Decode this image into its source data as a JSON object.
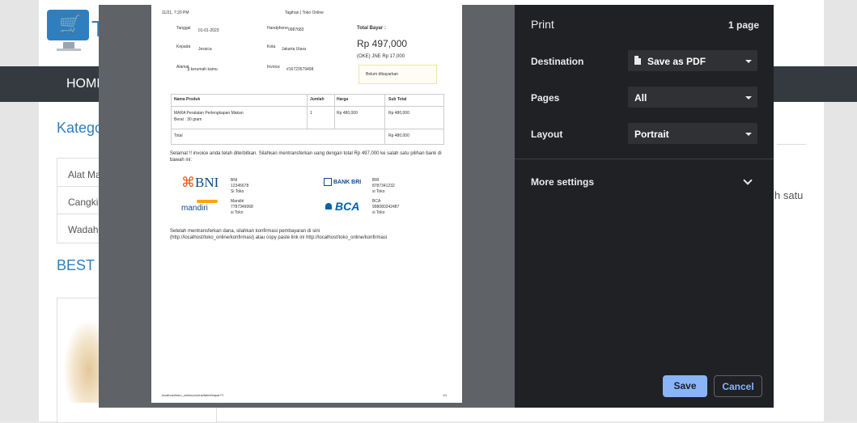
{
  "website": {
    "nav_home": "HOME",
    "logo_letter": "T",
    "category_title": "Kategori",
    "categories": [
      "Alat Mal",
      "Cangkir",
      "Wadah S"
    ],
    "best_seller_title": "BEST SEL",
    "side_text": "h satu"
  },
  "invoice": {
    "header_time": "11/21, 7:20 PM",
    "header_title": "Tagihan | Toko Online",
    "tanggal_label": "Tanggal",
    "tanggal_value": "01-01-2023",
    "handphone_label": "Handphone",
    "handphone_value": "0987683",
    "total_bayar_label": "Total Bayar :",
    "kepada_label": "Kepada",
    "kepada_value": "Jessica",
    "kota_label": "Kota",
    "kota_value": "Jakarta Utara",
    "total_amount": "Rp 497,000",
    "shipping": "(OKE) JNE Rp 17,000",
    "alamat_label": "Alamat",
    "alamat_value": "jl.kerumah kamu",
    "invoice_label": "Invoice",
    "invoice_value": "#16723579498",
    "status": "Belum dibayarkan",
    "table_headers": [
      "Nama Produk",
      "Jumlah",
      "Harga",
      "Sub Total"
    ],
    "row_product": "MARA Peralatan Perlengkapan Makan",
    "row_product_2": "Berat : 30 gram",
    "row_qty": "1",
    "row_price": "Rp 480,000",
    "row_subtotal": "Rp 480,000",
    "total_label": "Total",
    "total_value": "Rp 480,000",
    "message": "Selamat !! invoice anda telah diterbitkan. Silahkan mentransferkan uang dengan total Rp 497,000 ke salah satu pilihan bank di bawah ini:",
    "bni_logo": "BNI",
    "bni_info": [
      "BNI",
      "12345678",
      "Si Toko"
    ],
    "mandiri_logo": "mandiri",
    "mandiri_info": [
      "Mandiri",
      "7787349068",
      "si Toko"
    ],
    "bri_logo": "BANK BRI",
    "bri_info": [
      "BRI",
      "8787341232",
      "si Toko"
    ],
    "bca_logo": "BCA",
    "bca_info": [
      "BCA",
      "998080342487",
      "si Toko"
    ],
    "confirm_text": "Setelah mentransferkan dana, silahkan konfirmasi pembayaran di sini (http://localhost/toko_online/konfirmasi) atau copy paste link ini http://localhost/toko_online/konfirmasi",
    "footer_url": "localhost/toko_online/produk/tabel/bayar/?i",
    "footer_page": "1/1"
  },
  "print_panel": {
    "title": "Print",
    "page_count": "1 page",
    "destination_label": "Destination",
    "destination_value": "Save as PDF",
    "pages_label": "Pages",
    "pages_value": "All",
    "layout_label": "Layout",
    "layout_value": "Portrait",
    "more_settings_label": "More settings",
    "save_button": "Save",
    "cancel_button": "Cancel",
    "accent_color": "#8ab4f8"
  }
}
